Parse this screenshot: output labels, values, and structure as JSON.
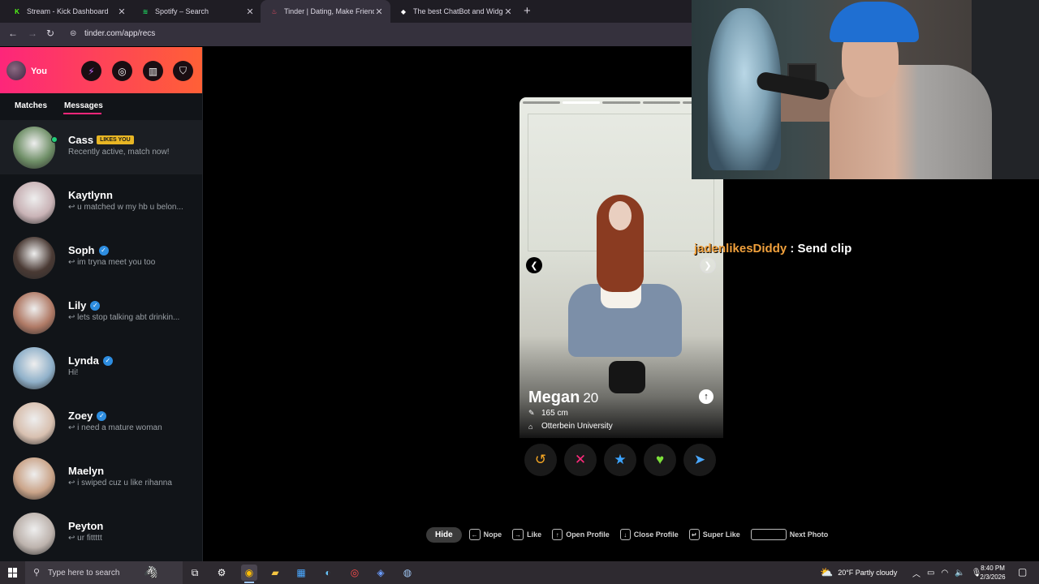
{
  "browser": {
    "tabs": [
      {
        "title": "Stream - Kick Dashboard",
        "icon": "kick-icon",
        "color": "#53fc18",
        "glyph": "K"
      },
      {
        "title": "Spotify – Search",
        "icon": "spotify-icon",
        "color": "#1ed760",
        "glyph": "≋"
      },
      {
        "title": "Tinder | Dating, Make Friends &",
        "icon": "tinder-icon",
        "color": "#fd5068",
        "glyph": "♨"
      },
      {
        "title": "The best ChatBot and Widgets",
        "icon": "botrix-icon",
        "color": "#ffffff",
        "glyph": "◆"
      }
    ],
    "active_tab": 2,
    "url": "tinder.com/app/recs"
  },
  "sidebar": {
    "user_label": "You",
    "tabs": {
      "matches": "Matches",
      "messages": "Messages"
    },
    "conversations": [
      {
        "name": "Cass",
        "badge": "LIKES YOU",
        "preview": "Recently active, match now!",
        "verified": false,
        "online": true,
        "avatar_color": "#6f8f67"
      },
      {
        "name": "Kaytlynn",
        "preview": "↩ u matched w my hb u belon...",
        "verified": false,
        "avatar_color": "#c9b3b6"
      },
      {
        "name": "Soph",
        "preview": "↩ im tryna meet you too",
        "verified": true,
        "avatar_color": "#4a3a34"
      },
      {
        "name": "Lily",
        "preview": "↩ lets stop talking abt drinkin...",
        "verified": true,
        "avatar_color": "#b07a66"
      },
      {
        "name": "Lynda",
        "preview": "Hi!",
        "verified": true,
        "avatar_color": "#8fb0c9"
      },
      {
        "name": "Zoey",
        "preview": "↩ i need a mature woman",
        "verified": true,
        "avatar_color": "#d8c0b0"
      },
      {
        "name": "Maelyn",
        "preview": "↩ i swiped cuz u like rihanna",
        "verified": false,
        "avatar_color": "#caa489"
      },
      {
        "name": "Peyton",
        "preview": "↩ ur fittttt",
        "verified": false,
        "avatar_color": "#bdb3ad"
      }
    ]
  },
  "profile": {
    "name": "Megan",
    "age": "20",
    "height": "165 cm",
    "school": "Otterbein University",
    "photo_count": 5,
    "current_photo": 2
  },
  "actions": [
    {
      "name": "rewind-button",
      "glyph": "↺",
      "color": "#f5a623"
    },
    {
      "name": "nope-button",
      "glyph": "✕",
      "color": "#fd2a7b"
    },
    {
      "name": "super-like-button",
      "glyph": "★",
      "color": "#3ca4ff"
    },
    {
      "name": "like-button",
      "glyph": "♥",
      "color": "#7ce03a"
    },
    {
      "name": "boost-button",
      "glyph": "➤",
      "color": "#4aa8ff"
    }
  ],
  "hints": {
    "hide": "Hide",
    "items": [
      {
        "key": "←",
        "label": "Nope"
      },
      {
        "key": "→",
        "label": "Like"
      },
      {
        "key": "↑",
        "label": "Open Profile"
      },
      {
        "key": "↓",
        "label": "Close Profile"
      },
      {
        "key": "↵",
        "label": "Super Like"
      },
      {
        "key": "",
        "label": "Next Photo",
        "wide": true
      }
    ]
  },
  "chat": {
    "user": "jadenlikesDiddy",
    "message": " : Send clip"
  },
  "taskbar": {
    "search_placeholder": "Type here to search",
    "weather": "20°F  Partly cloudy",
    "time": "8:40 PM",
    "date": "2/3/2026"
  }
}
